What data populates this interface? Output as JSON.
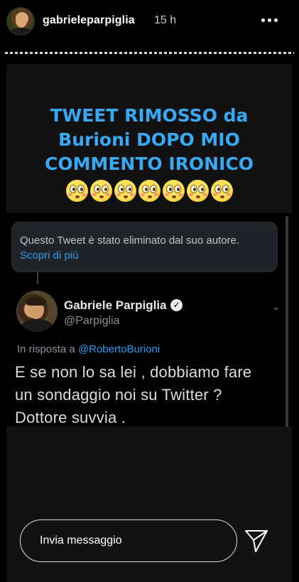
{
  "header": {
    "username": "gabrieleparpiglia",
    "time_ago": "15 h"
  },
  "story": {
    "caption_lines": [
      "TWEET RIMOSSO da",
      "Burioni DOPO MIO",
      "COMMENTO IRONICO"
    ],
    "emoji_count": 7,
    "emoji_icon": "flushed-face"
  },
  "tweet": {
    "deleted_notice": "Questo Tweet è stato eliminato dal suo autore.",
    "learn_more": "Scopri di più",
    "author_name": "Gabriele Parpiglia",
    "author_handle": "@Parpiglia",
    "reply_prefix": "In risposta a",
    "reply_mention": "@RobertoBurioni",
    "body_lines": [
      "E se non lo sa lei , dobbiamo fare",
      "un sondaggio noi su Twitter ?",
      "Dottore suvvia ."
    ]
  },
  "composer": {
    "placeholder": "Invia messaggio"
  },
  "colors": {
    "caption": "#39a9f5",
    "link": "#2d9cf0",
    "background": "#000000"
  }
}
